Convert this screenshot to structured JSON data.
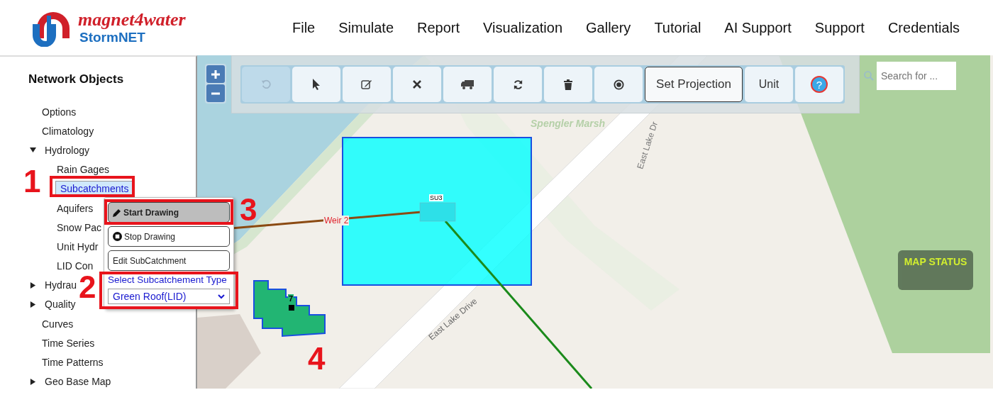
{
  "brand": {
    "name": "magnet4water",
    "product": "StormNET"
  },
  "nav": [
    "File",
    "Simulate",
    "Report",
    "Visualization",
    "Gallery",
    "Tutorial",
    "AI Support",
    "Support",
    "Credentials"
  ],
  "sidebar": {
    "title": "Network Objects",
    "items": [
      {
        "label": "Options",
        "selected": false
      },
      {
        "label": "Climatology",
        "selected": false
      },
      {
        "label": "Hydrology",
        "selected": false,
        "expanded": true,
        "children": [
          {
            "label": "Rain Gages",
            "selected": false
          },
          {
            "label": "Subcatchments",
            "selected": true
          },
          {
            "label": "Aquifers",
            "selected": false
          },
          {
            "label": "Snow Pac",
            "selected": false
          },
          {
            "label": "Unit Hydr",
            "selected": false
          },
          {
            "label": "LID Con",
            "selected": false
          }
        ]
      },
      {
        "label": "Hydrau",
        "selected": false,
        "expanded": false
      },
      {
        "label": "Quality",
        "selected": false,
        "expanded": false
      },
      {
        "label": "Curves",
        "selected": false
      },
      {
        "label": "Time Series",
        "selected": false
      },
      {
        "label": "Time Patterns",
        "selected": false
      },
      {
        "label": "Geo Base Map",
        "selected": false,
        "expanded": false
      }
    ]
  },
  "context_menu": {
    "buttons": [
      {
        "kind": "pencil",
        "label": "Start Drawing",
        "selected": true
      },
      {
        "kind": "stop",
        "label": "Stop Drawing",
        "selected": false
      },
      {
        "kind": "plain",
        "label": "Edit SubCatchment",
        "selected": false
      }
    ],
    "type_label": "Select Subcatchement Type",
    "type_value": "Green Roof(LID)"
  },
  "toolbar": [
    {
      "kind": "undo",
      "disabled": true
    },
    {
      "kind": "pointer",
      "disabled": false
    },
    {
      "kind": "edit",
      "disabled": false
    },
    {
      "kind": "delete",
      "disabled": false
    },
    {
      "kind": "truck",
      "disabled": false
    },
    {
      "kind": "refresh",
      "disabled": false
    },
    {
      "kind": "trash",
      "disabled": false
    },
    {
      "kind": "record",
      "disabled": false
    },
    {
      "kind": "text",
      "label": "Set Projection",
      "disabled": false
    },
    {
      "kind": "text",
      "label": "Unit",
      "disabled": false
    },
    {
      "kind": "help",
      "label": "?",
      "disabled": false
    }
  ],
  "search": {
    "placeholder": "Search for ..."
  },
  "map": {
    "area_label": "Spengler Marsh",
    "road_labels": [
      "East Lake Dr",
      "East Lake Drive"
    ],
    "link_label": "Weir 2",
    "storage_label": "SU3",
    "subcatchment_label": "7",
    "status": "MAP STATUS"
  },
  "annotations": [
    {
      "label": "1",
      "boxed": true
    },
    {
      "label": "2",
      "boxed": true
    },
    {
      "label": "3",
      "boxed": true
    },
    {
      "label": "4",
      "boxed": false
    }
  ]
}
